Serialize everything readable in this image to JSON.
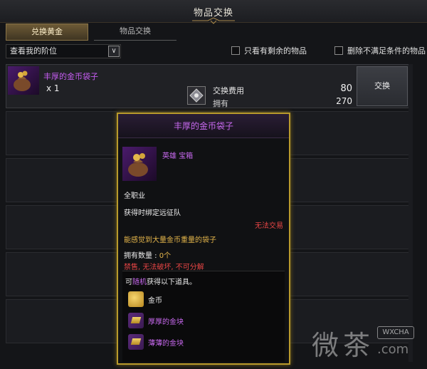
{
  "window": {
    "title": "物品交换"
  },
  "tabs": [
    {
      "label": "兑换黄金",
      "active": true
    },
    {
      "label": "物品交换",
      "active": false
    }
  ],
  "filter": {
    "select_value": "查看我的阶位",
    "option_remaining_label": "只看有剩余的物品",
    "option_remove_unmet_label": "删除不满足条件的物品"
  },
  "exchange_row": {
    "item_name": "丰厚的金币袋子",
    "quantity": "x 1",
    "cost_label": "交换费用",
    "cost_value": "80",
    "own_label": "拥有",
    "own_value": "270",
    "button_label": "交换"
  },
  "tooltip": {
    "title": "丰厚的金币袋子",
    "grade": "英雄 宝箱",
    "class": "全职业",
    "bind": "获得时绑定远征队",
    "trade": "无法交易",
    "desc": "能感觉到大量金币重量的袋子",
    "own_count_label": "拥有数量 : ",
    "own_count_value": "0个",
    "flags_prefix": "禁售, ",
    "flags_mid": "无法破坏",
    "flags_suffix": ", 不可分解",
    "random_prefix": "可",
    "random_highlight": "随机",
    "random_suffix": "获得以下道具。",
    "rewards": [
      {
        "name": "金币",
        "color": "white",
        "icon": "gold-coin-icon"
      },
      {
        "name": "厚厚的金块",
        "color": "purple",
        "icon": "gold-bar-icon"
      },
      {
        "name": "薄薄的金块",
        "color": "purple",
        "icon": "gold-bar-icon"
      }
    ]
  },
  "watermark": {
    "char1": "微",
    "char2": "茶",
    "badge": "WXCHA",
    "domain": ".com"
  },
  "colors": {
    "epic_purple": "#c869ef",
    "gold_border": "#b99a2c",
    "warning_red": "#e84545",
    "accent_gold": "#e5b64b"
  }
}
